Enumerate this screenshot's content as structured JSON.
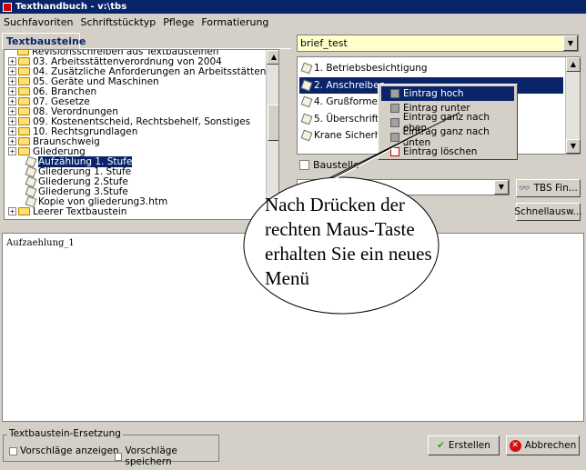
{
  "window": {
    "title": "Texthandbuch - v:\\tbs"
  },
  "menu": [
    "Suchfavoriten",
    "Schriftstücktyp",
    "Pflege",
    "Formatierung"
  ],
  "tab": {
    "label": "Textbausteine"
  },
  "tree": {
    "items": [
      {
        "label": "Revisionsschreiben aus Textbausteinen",
        "type": "folder",
        "indent": 1,
        "expander": false
      },
      {
        "label": "03. Arbeitsstättenverordnung von 2004",
        "type": "folder",
        "indent": 0,
        "expander": true
      },
      {
        "label": "04. Zusätzliche Anforderungen an Arbeitsstätten",
        "type": "folder",
        "indent": 0,
        "expander": true
      },
      {
        "label": "05. Geräte und Maschinen",
        "type": "folder",
        "indent": 0,
        "expander": true
      },
      {
        "label": "06. Branchen",
        "type": "folder",
        "indent": 0,
        "expander": true
      },
      {
        "label": "07. Gesetze",
        "type": "folder",
        "indent": 0,
        "expander": true
      },
      {
        "label": "08. Verordnungen",
        "type": "folder",
        "indent": 0,
        "expander": true
      },
      {
        "label": "09. Kostenentscheid, Rechtsbehelf, Sonstiges",
        "type": "folder",
        "indent": 0,
        "expander": true
      },
      {
        "label": "10. Rechtsgrundlagen",
        "type": "folder",
        "indent": 0,
        "expander": true
      },
      {
        "label": "Braunschweig",
        "type": "folder",
        "indent": 0,
        "expander": true
      },
      {
        "label": "Gliederung",
        "type": "folder",
        "indent": 0,
        "expander": true
      },
      {
        "label": "Aufzählung 1. Stufe",
        "type": "doc",
        "indent": 2,
        "expander": false,
        "selected": true
      },
      {
        "label": "Gliederung 1. Stufe",
        "type": "doc",
        "indent": 2,
        "expander": false
      },
      {
        "label": "Gliederung 2.Stufe",
        "type": "doc",
        "indent": 2,
        "expander": false
      },
      {
        "label": "Gliederung 3.Stufe",
        "type": "doc",
        "indent": 2,
        "expander": false
      },
      {
        "label": "Kopie von gliederung3.htm",
        "type": "doc",
        "indent": 2,
        "expander": false
      },
      {
        "label": "Leerer Textbaustein",
        "type": "folder",
        "indent": 0,
        "expander": true
      }
    ]
  },
  "document_combo": {
    "value": "brief_test"
  },
  "doc_list": {
    "items": [
      {
        "label": "1. Betriebsbesichtigung"
      },
      {
        "label": "2. Anschreiben",
        "selected": true
      },
      {
        "label": "4. Grußformel"
      },
      {
        "label": "5. Überschrift: N"
      },
      {
        "label": "Krane Sicherhe"
      }
    ]
  },
  "baustelle": {
    "label": "Baustelle"
  },
  "buttons": {
    "tbs_find": "TBS Fin...",
    "quick_select": "Schnellausw...",
    "create": "Erstellen",
    "cancel": "Abbrechen"
  },
  "editor": {
    "content": "Aufzaehlung_1"
  },
  "replacement_group": {
    "legend": "Textbaustein-Ersetzung",
    "show_suggestions": "Vorschläge anzeigen",
    "save_suggestions": "Vorschläge speichern"
  },
  "context_menu": {
    "items": [
      {
        "label": "Eintrag hoch",
        "icon": "arrow-up-icon"
      },
      {
        "label": "Eintrag runter",
        "icon": "arrow-down-icon"
      },
      {
        "label": "Eintrag ganz nach oben",
        "icon": "arrow-top-icon"
      },
      {
        "label": "Eintrag ganz nach unten",
        "icon": "arrow-bottom-icon"
      },
      {
        "label": "Eintrag löschen",
        "icon": "delete-icon"
      }
    ]
  },
  "callout": {
    "text": "Nach Drücken der rechten Maus-Taste erhalten Sie ein neues Menü"
  }
}
